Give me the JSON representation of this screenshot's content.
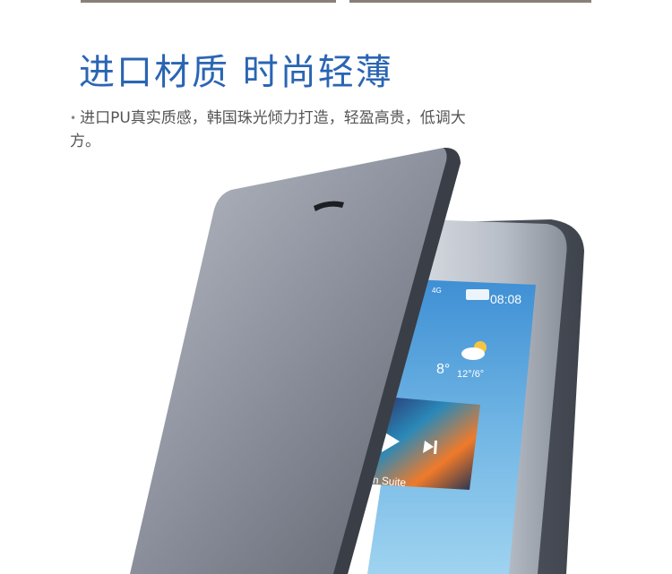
{
  "headline": "进口材质 时尚轻薄",
  "description": "进口PU真实质感，韩国珠光倾力打造，轻盈高贵，低调大方。",
  "phone_screen": {
    "status_time": "08:08",
    "status_network": "4G",
    "weather_temp": "8°",
    "weather_range": "12°/6°",
    "weather_icon": "partly-cloudy-icon",
    "music_title": "Bach Suite"
  },
  "colors": {
    "headline": "#2a65b3",
    "text": "#555555",
    "cover": "#7c8290",
    "screen": "#5aa8d8"
  }
}
